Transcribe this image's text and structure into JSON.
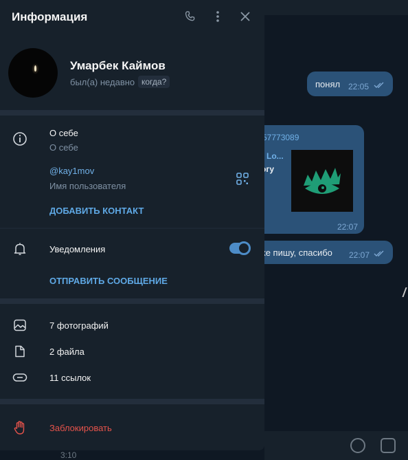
{
  "header": {
    "title": "Информация",
    "icons": [
      "phone-icon",
      "more-vertical-icon",
      "close-icon"
    ]
  },
  "profile": {
    "name": "Умарбек Каймов",
    "status": "был(а) недавно",
    "when_label": "когда?"
  },
  "info": {
    "about_value": "О себе",
    "about_label": "О себе",
    "username": "@kay1mov",
    "username_label": "Имя пользователя",
    "add_contact": "ДОБАВИТЬ КОНТАКТ",
    "notifications": "Уведомления",
    "notifications_on": true,
    "send_message": "ОТПРАВИТЬ СООБЩЕНИЕ"
  },
  "media": {
    "photos": "7 фотографий",
    "files": "2 файла",
    "links": "11 ссылок"
  },
  "danger": {
    "block": "Заблокировать"
  },
  "chat": {
    "msg1_text": "понял",
    "msg1_time": "22:05",
    "fwd_from": "57773089",
    "fwd_title": "Lo...",
    "fwd_text": "огу",
    "fwd_time": "22:07",
    "msg2_text": "же пишу, спасибо",
    "msg2_time": "22:07",
    "bottom_time": "3:10"
  },
  "colors": {
    "panel_bg": "#17212b",
    "chat_bg": "#0e1621",
    "accent": "#5fa9e6",
    "danger": "#e5534b",
    "bubble": "#2b5278"
  }
}
